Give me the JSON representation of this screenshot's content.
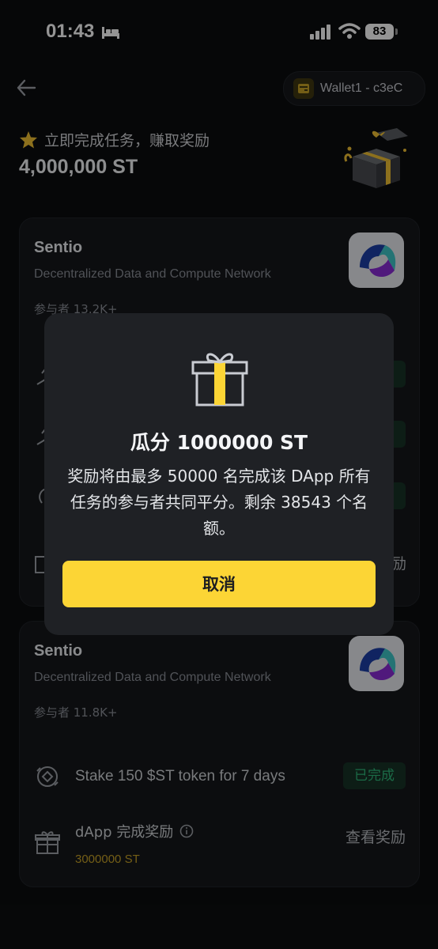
{
  "status_bar": {
    "time": "01:43",
    "battery": "83"
  },
  "header": {
    "wallet_label": "Wallet1 - c3eC"
  },
  "banner": {
    "title": "立即完成任务，赚取奖励",
    "amount": "4,000,000 ST"
  },
  "cards": [
    {
      "title": "Sentio",
      "subtitle": "Decentralized Data and Compute Network",
      "participants": "参与者  13.2K+",
      "partial_reward_label": "励"
    },
    {
      "title": "Sentio",
      "subtitle": "Decentralized Data and Compute Network",
      "participants": "参与者  11.8K+",
      "task": {
        "label": "Stake 150 $ST token for 7 days",
        "status": "已完成"
      },
      "reward": {
        "label": "dApp 完成奖励",
        "amount": "3000000 ST",
        "action": "查看奖励"
      }
    }
  ],
  "modal": {
    "title": "瓜分 1000000 ST",
    "description": "奖励将由最多 50000 名完成该 DApp 所有任务的参与者共同平分。剩余 38543 个名额。",
    "cancel_label": "取消"
  },
  "colors": {
    "accent": "#fcd535",
    "success": "#2fb87a",
    "background": "#0c0d0f"
  }
}
